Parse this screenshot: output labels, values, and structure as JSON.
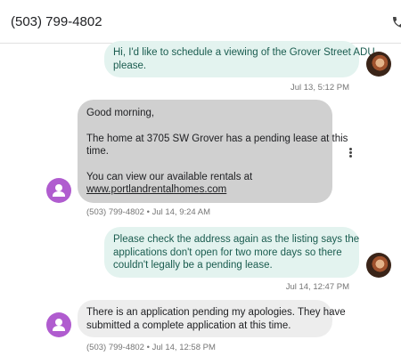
{
  "header": {
    "contact_number": "(503) 799-4802"
  },
  "messages": [
    {
      "direction": "outgoing",
      "lines": [
        "Hi, I'd like to schedule a viewing of the Grover Street ADU",
        "please."
      ],
      "timestamp": "Jul 13, 5:12 PM"
    },
    {
      "direction": "incoming",
      "lines": [
        "Good morning,",
        "The home at 3705 SW Grover has a pending lease at this",
        "time.",
        "You can view our available rentals at"
      ],
      "link": "www.portlandrentalhomes.com",
      "timestamp": "(503) 799-4802 • Jul 14, 9:24 AM"
    },
    {
      "direction": "outgoing",
      "lines": [
        "Please check the address again as the listing says the",
        "applications don't open for two more days so there",
        "couldn't legally be a pending lease."
      ],
      "timestamp": "Jul 14, 12:47 PM"
    },
    {
      "direction": "incoming",
      "lines": [
        "There is an application pending my apologies. They have",
        "submitted a complete application at this time."
      ],
      "timestamp": "(503) 799-4802 • Jul 14, 12:58 PM"
    }
  ],
  "colors": {
    "outgoing_bubble": "#e3f3ef",
    "outgoing_text": "#1a5c4f",
    "incoming_bubble": "#d0d0d0",
    "contact_avatar": "#b05ccf"
  },
  "icons": {
    "call": "phone-icon",
    "more": "more-vert-icon",
    "contact_avatar": "person-icon"
  }
}
